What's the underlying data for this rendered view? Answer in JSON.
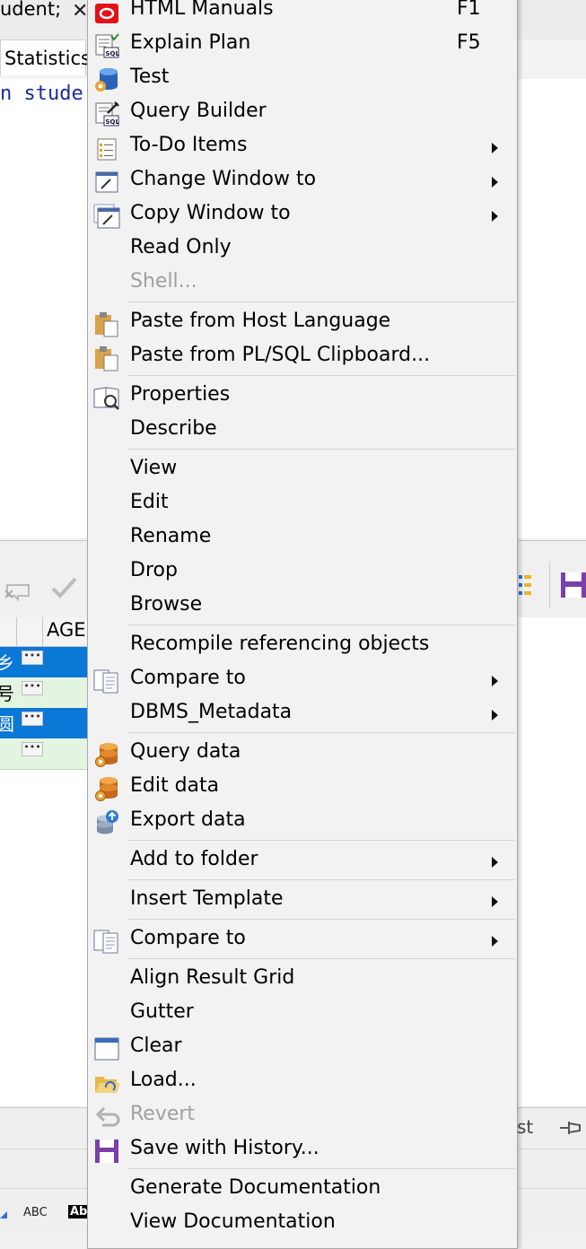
{
  "background": {
    "tab_student": "udent;",
    "tab_close": "✕",
    "tab_statistics": "Statistics",
    "editor_code": "n stude",
    "grid": {
      "age_header": "AGE",
      "row_chars": [
        "乡",
        "号",
        "圆",
        ""
      ]
    },
    "status": {
      "abc": "ABC",
      "ab": "Ab",
      "st": "st"
    }
  },
  "menu": {
    "items": [
      {
        "label": "HTML Manuals",
        "shortcut": "F1"
      },
      {
        "label": "Explain Plan",
        "shortcut": "F5"
      },
      {
        "label": "Test"
      },
      {
        "label": "Query Builder"
      },
      {
        "label": "To-Do Items"
      },
      {
        "label": "Change Window to"
      },
      {
        "label": "Copy Window to"
      },
      {
        "label": "Read Only"
      },
      {
        "label": "Shell..."
      },
      {
        "label": "Paste from Host Language"
      },
      {
        "label": "Paste from PL/SQL Clipboard..."
      },
      {
        "label": "Properties"
      },
      {
        "label": "Describe"
      },
      {
        "label": "View"
      },
      {
        "label": "Edit"
      },
      {
        "label": "Rename"
      },
      {
        "label": "Drop"
      },
      {
        "label": "Browse"
      },
      {
        "label": "Recompile referencing objects"
      },
      {
        "label": "Compare to"
      },
      {
        "label": "DBMS_Metadata"
      },
      {
        "label": "Query data"
      },
      {
        "label": "Edit data"
      },
      {
        "label": "Export data"
      },
      {
        "label": "Add to folder"
      },
      {
        "label": "Insert Template"
      },
      {
        "label": "Compare to"
      },
      {
        "label": "Align Result Grid"
      },
      {
        "label": "Gutter"
      },
      {
        "label": "Clear"
      },
      {
        "label": "Load..."
      },
      {
        "label": "Revert"
      },
      {
        "label": "Save with History..."
      },
      {
        "label": "Generate Documentation"
      },
      {
        "label": "View Documentation"
      }
    ]
  }
}
